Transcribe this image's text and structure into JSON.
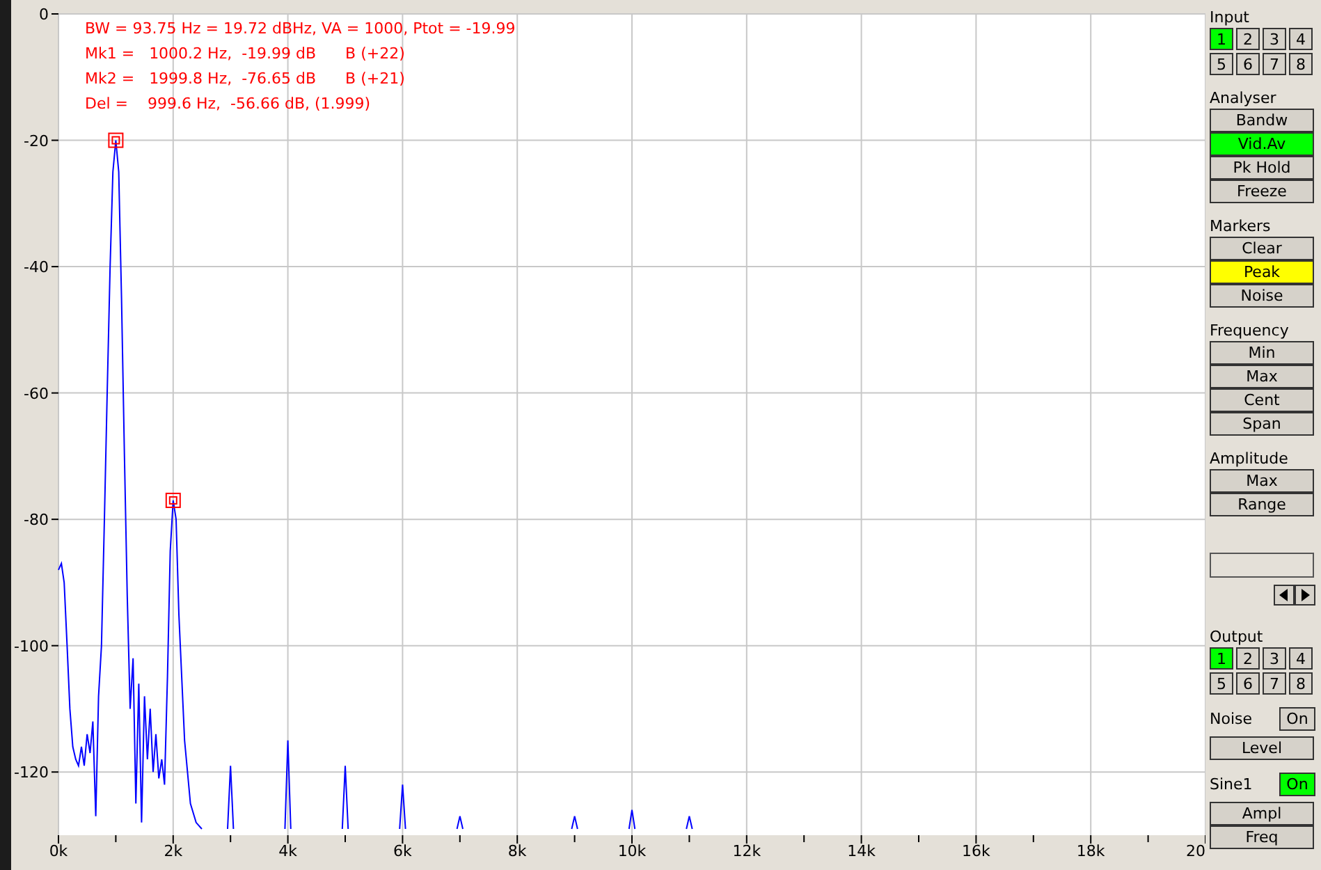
{
  "readout": [
    "BW = 93.75 Hz = 19.72 dBHz, VA = 1000, Ptot = -19.99",
    "Mk1 =   1000.2 Hz,  -19.99 dB      B (+22)",
    "Mk2 =   1999.8 Hz,  -76.65 dB      B (+21)",
    "Del =    999.6 Hz,  -56.66 dB, (1.999)"
  ],
  "chart_data": {
    "type": "line",
    "xlim": [
      0,
      20
    ],
    "ylim": [
      -130,
      0
    ],
    "grid": true,
    "xticks": [
      {
        "value": 0,
        "label": "0k"
      },
      {
        "value": 2,
        "label": "2k"
      },
      {
        "value": 4,
        "label": "4k"
      },
      {
        "value": 6,
        "label": "6k"
      },
      {
        "value": 8,
        "label": "8k"
      },
      {
        "value": 10,
        "label": "10k"
      },
      {
        "value": 12,
        "label": "12k"
      },
      {
        "value": 14,
        "label": "14k"
      },
      {
        "value": 16,
        "label": "16k"
      },
      {
        "value": 18,
        "label": "18k"
      },
      20
    ],
    "yticks": [
      0,
      -20,
      -40,
      -60,
      -80,
      -100,
      -120
    ],
    "x": [
      0,
      0.05,
      0.1,
      0.15,
      0.2,
      0.25,
      0.3,
      0.35,
      0.4,
      0.45,
      0.5,
      0.55,
      0.6,
      0.65,
      0.7,
      0.75,
      0.8,
      0.85,
      0.9,
      0.95,
      1,
      1.05,
      1.1,
      1.15,
      1.2,
      1.25,
      1.3,
      1.35,
      1.4,
      1.45,
      1.5,
      1.55,
      1.6,
      1.65,
      1.7,
      1.75,
      1.8,
      1.85,
      1.9,
      1.95,
      2,
      2.05,
      2.1,
      2.2,
      2.3,
      2.4,
      2.5,
      2.7,
      2.95,
      3,
      3.05,
      3.5,
      3.95,
      4,
      4.05,
      4.5,
      4.95,
      5,
      5.05,
      5.5,
      5.95,
      6,
      6.05,
      6.5,
      6.95,
      7,
      7.05,
      8,
      8.95,
      9,
      9.05,
      9.5,
      9.95,
      10,
      10.05,
      10.5,
      10.95,
      11,
      11.05
    ],
    "values": [
      -88,
      -87,
      -90,
      -100,
      -110,
      -116,
      -118,
      -119,
      -116,
      -119,
      -114,
      -117,
      -112,
      -127,
      -108,
      -100,
      -80,
      -60,
      -40,
      -25,
      -20,
      -25,
      -45,
      -70,
      -92,
      -110,
      -102,
      -125,
      -106,
      -128,
      -108,
      -118,
      -110,
      -120,
      -114,
      -121,
      -118,
      -122,
      -105,
      -85,
      -77,
      -80,
      -95,
      -115,
      -125,
      -128,
      -129,
      null,
      -129,
      -119,
      -129,
      null,
      -129,
      -115,
      -129,
      null,
      -129,
      -119,
      -129,
      null,
      -129,
      -122,
      -129,
      null,
      -129,
      -127,
      -129,
      null,
      -129,
      -127,
      -129,
      null,
      -129,
      -126,
      -129,
      null,
      -129,
      -127,
      -129
    ]
  },
  "panel": [
    {
      "kind": "channel-grid",
      "title": "Input",
      "channels": [
        {
          "label": "1",
          "selected": true
        },
        {
          "label": "2",
          "selected": false
        },
        {
          "label": "3",
          "selected": false
        },
        {
          "label": "4",
          "selected": false
        },
        {
          "label": "5",
          "selected": false
        },
        {
          "label": "6",
          "selected": false
        },
        {
          "label": "7",
          "selected": false
        },
        {
          "label": "8",
          "selected": false
        }
      ]
    },
    {
      "kind": "buttons",
      "title": "Analyser",
      "buttons": [
        {
          "label": "Bandw",
          "on": false
        },
        {
          "label": "Vid.Av",
          "on": true
        },
        {
          "label": "Pk Hold",
          "on": false
        },
        {
          "label": "Freeze",
          "on": false
        }
      ]
    },
    {
      "kind": "marker-buttons",
      "title": "Markers",
      "buttons": [
        {
          "label": "Clear",
          "on": false
        },
        {
          "label": "Peak",
          "on": true
        },
        {
          "label": "Noise",
          "on": false
        }
      ]
    },
    {
      "kind": "buttons",
      "title": "Frequency",
      "buttons": [
        {
          "label": "Min",
          "on": false
        },
        {
          "label": "Max",
          "on": false
        },
        {
          "label": "Cent",
          "on": false
        },
        {
          "label": "Span",
          "on": false
        }
      ]
    },
    {
      "kind": "buttons",
      "title": "Amplitude",
      "buttons": [
        {
          "label": "Max",
          "on": false
        },
        {
          "label": "Range",
          "on": false
        }
      ]
    },
    {
      "kind": "field"
    },
    {
      "kind": "channel-grid",
      "title": "Output",
      "channels": [
        {
          "label": "1",
          "selected": true
        },
        {
          "label": "2",
          "selected": false
        },
        {
          "label": "3",
          "selected": false
        },
        {
          "label": "4",
          "selected": false
        },
        {
          "label": "5",
          "selected": false
        },
        {
          "label": "6",
          "selected": false
        },
        {
          "label": "7",
          "selected": false
        },
        {
          "label": "8",
          "selected": false
        }
      ]
    },
    {
      "kind": "switch",
      "title": "Noise",
      "switch": {
        "label": "On",
        "on": false
      },
      "buttons": [
        {
          "label": "Level",
          "on": false
        }
      ]
    },
    {
      "kind": "switch",
      "title": "Sine1",
      "switch": {
        "label": "On",
        "on": true
      },
      "buttons": [
        {
          "label": "Ampl",
          "on": false
        },
        {
          "label": "Freq",
          "on": false
        }
      ]
    }
  ]
}
